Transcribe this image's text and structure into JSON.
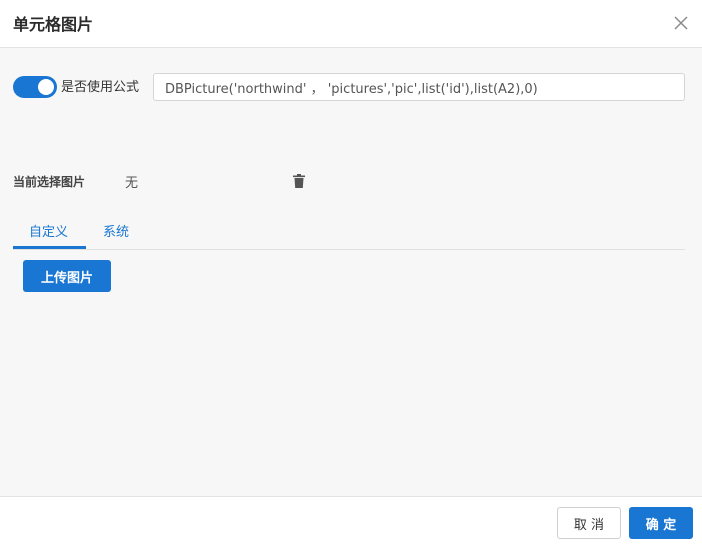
{
  "dialog": {
    "title": "单元格图片",
    "close_icon": "close-icon"
  },
  "formula": {
    "toggle_on": true,
    "toggle_label": "是否使用公式",
    "value": "DBPicture('northwind' ， 'pictures','pic',list('id'),list(A2),0)"
  },
  "current_picture": {
    "label": "当前选择图片",
    "value": "无",
    "delete_icon": "trash-icon"
  },
  "tabs": [
    {
      "label": "自定义",
      "active": true
    },
    {
      "label": "系统",
      "active": false
    }
  ],
  "upload_button": "上传图片",
  "footer": {
    "cancel_label": "取 消",
    "ok_label": "确 定"
  },
  "colors": {
    "accent": "#1976d2",
    "body_bg": "#f7f7f7"
  }
}
